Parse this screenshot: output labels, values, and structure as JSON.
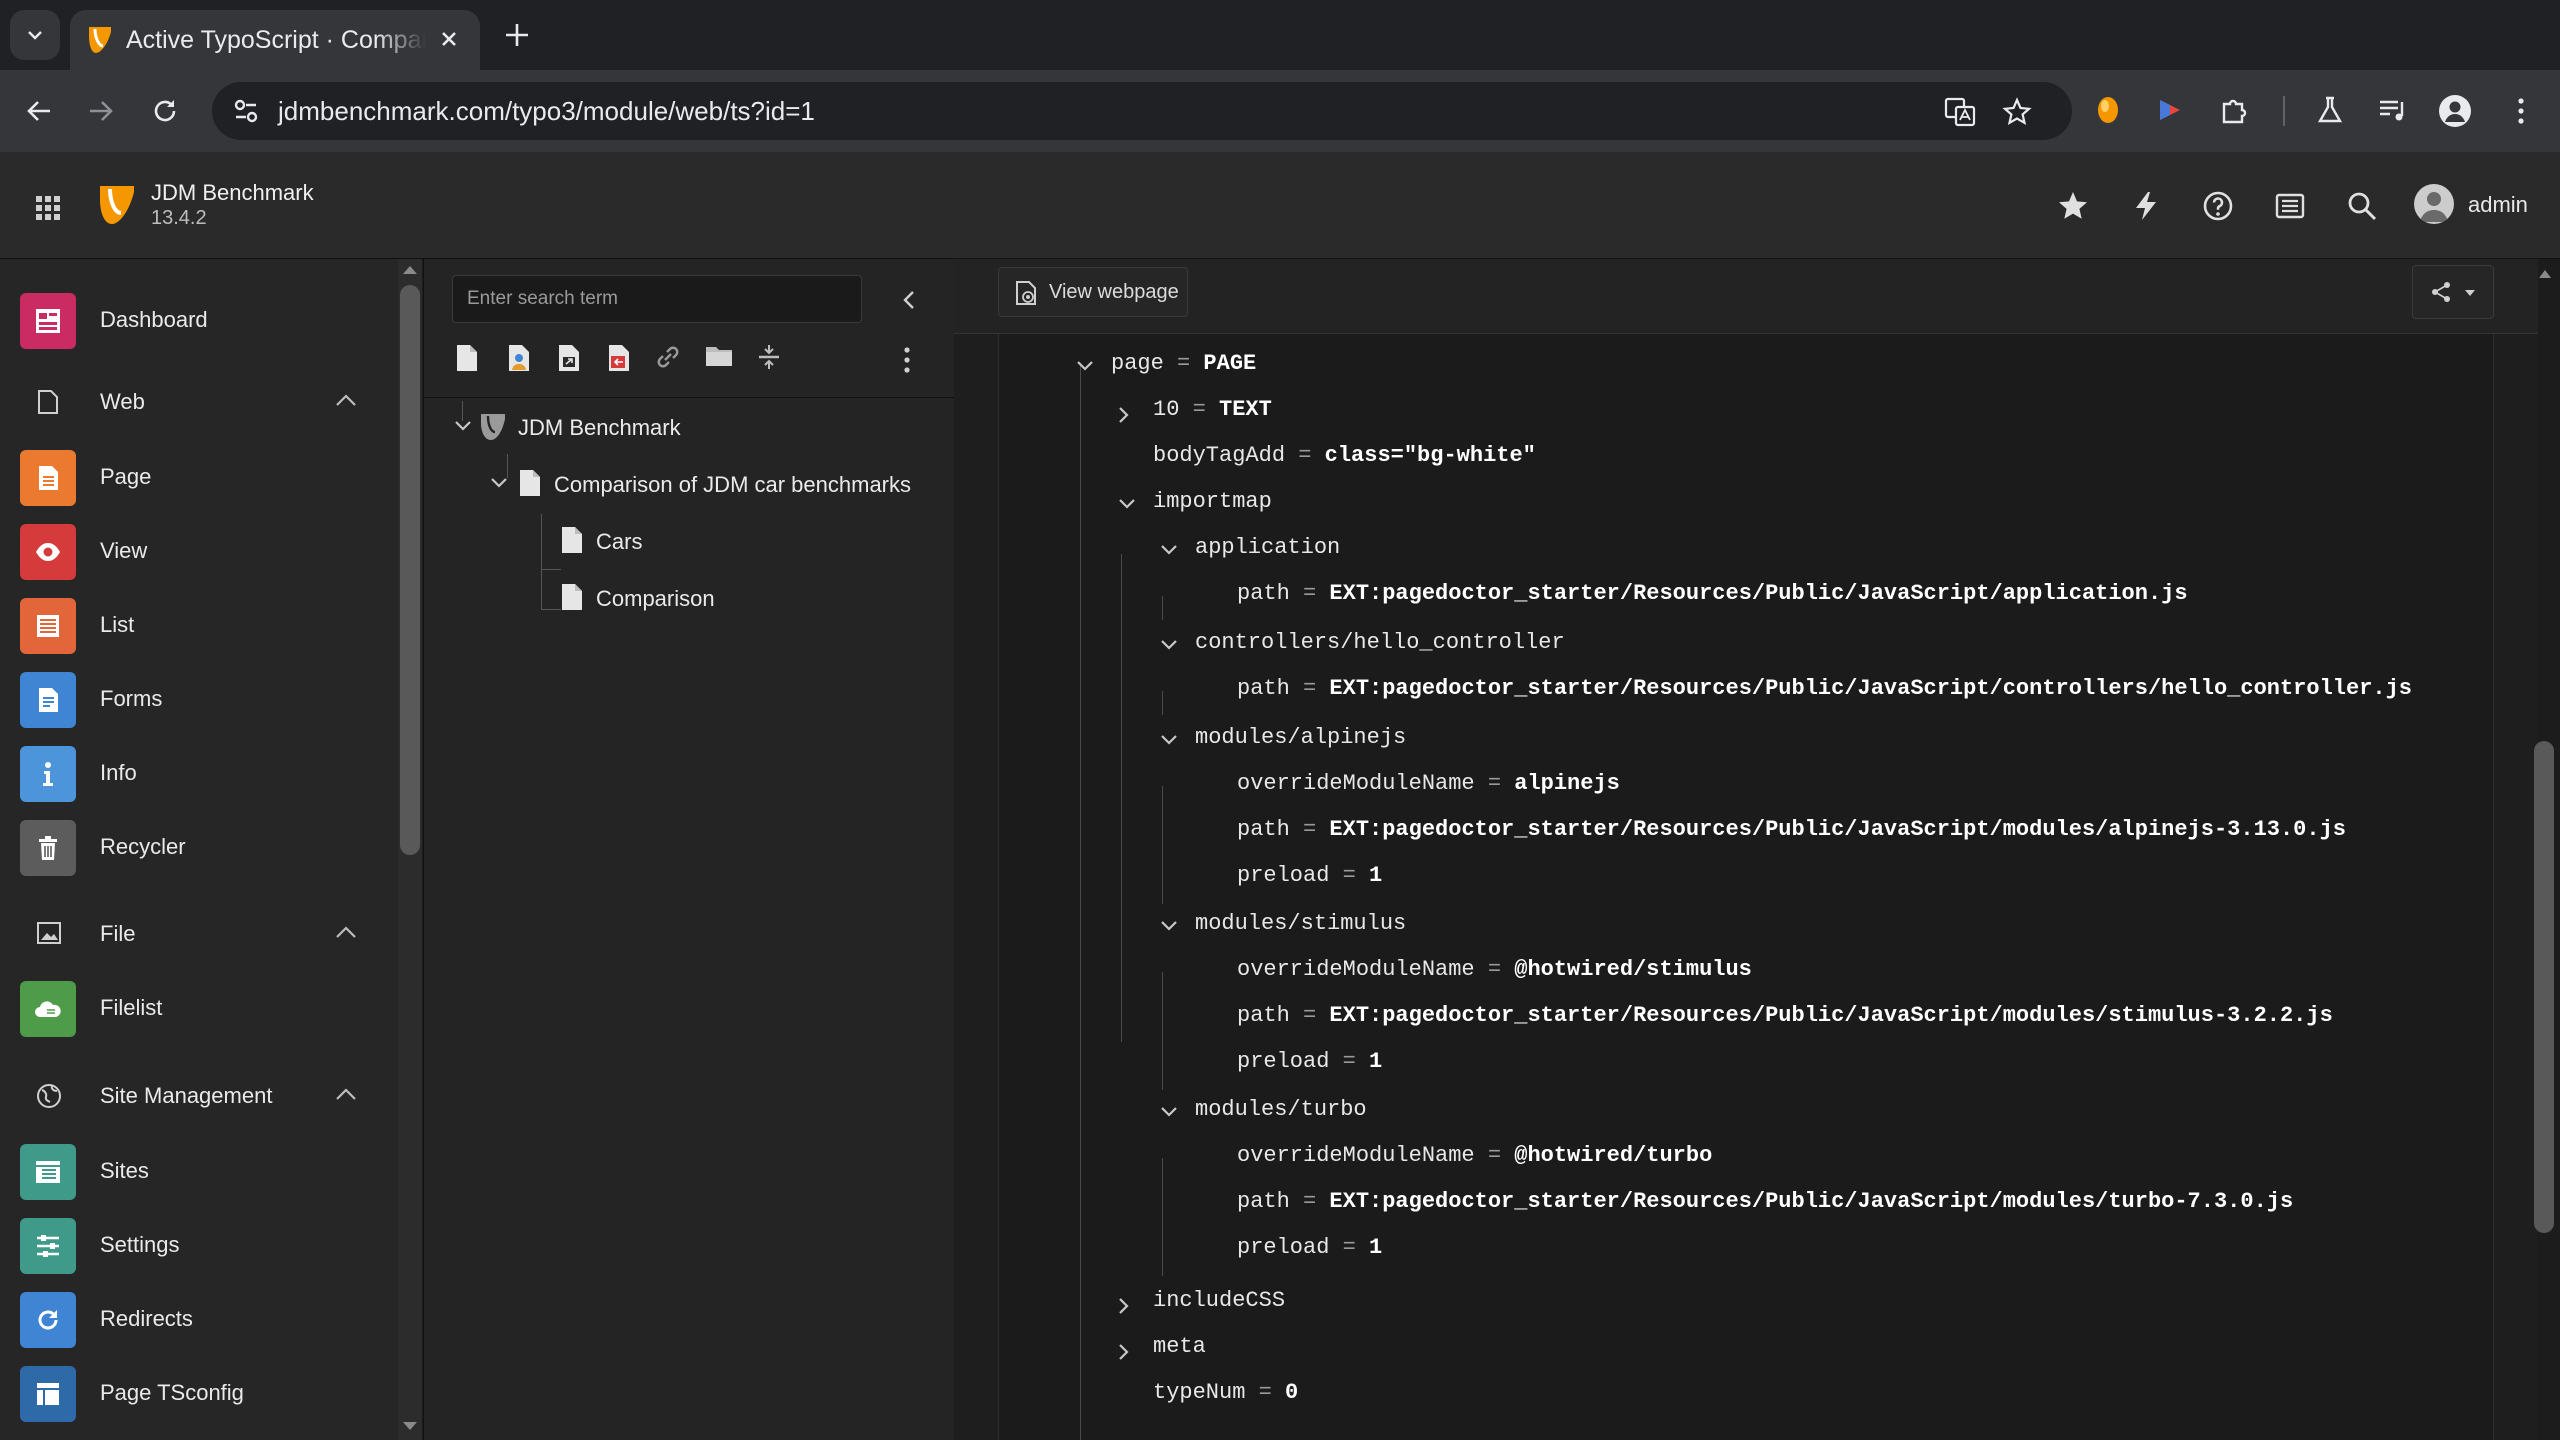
{
  "browser": {
    "tab_title": "Active TypoScript · Comparison of JDM car benchmarks",
    "url": "jdmbenchmark.com/typo3/module/web/ts?id=1"
  },
  "topbar": {
    "site_name": "JDM Benchmark",
    "version": "13.4.2",
    "username": "admin"
  },
  "modules": {
    "dashboard": "Dashboard",
    "web": "Web",
    "page": "Page",
    "view": "View",
    "list": "List",
    "forms": "Forms",
    "info": "Info",
    "recycler": "Recycler",
    "file": "File",
    "filelist": "Filelist",
    "site_management": "Site Management",
    "sites": "Sites",
    "settings": "Settings",
    "redirects": "Redirects",
    "page_tsconfig": "Page TSconfig"
  },
  "tree": {
    "search_placeholder": "Enter search term",
    "root": "JDM Benchmark",
    "page1": "Comparison of JDM car benchmarks",
    "page2": "Cars",
    "page3": "Comparison"
  },
  "content": {
    "view_webpage": "View webpage"
  },
  "typoscript": {
    "r0": {
      "key": "page",
      "op": "=",
      "val": "PAGE"
    },
    "r1": {
      "key": "10",
      "op": "=",
      "val": "TEXT"
    },
    "r2": {
      "key": "bodyTagAdd",
      "op": "=",
      "val": "class=\"bg-white\""
    },
    "r3": {
      "key": "importmap"
    },
    "r4": {
      "key": "application"
    },
    "r5": {
      "key": "path",
      "op": "=",
      "val": "EXT:pagedoctor_starter/Resources/Public/JavaScript/application.js"
    },
    "r6": {
      "key": "controllers/hello_controller"
    },
    "r7": {
      "key": "path",
      "op": "=",
      "val": "EXT:pagedoctor_starter/Resources/Public/JavaScript/controllers/hello_controller.js"
    },
    "r8": {
      "key": "modules/alpinejs"
    },
    "r9": {
      "key": "overrideModuleName",
      "op": "=",
      "val": "alpinejs"
    },
    "r10": {
      "key": "path",
      "op": "=",
      "val": "EXT:pagedoctor_starter/Resources/Public/JavaScript/modules/alpinejs-3.13.0.js"
    },
    "r11": {
      "key": "preload",
      "op": "=",
      "val": "1"
    },
    "r12": {
      "key": "modules/stimulus"
    },
    "r13": {
      "key": "overrideModuleName",
      "op": "=",
      "val": "@hotwired/stimulus"
    },
    "r14": {
      "key": "path",
      "op": "=",
      "val": "EXT:pagedoctor_starter/Resources/Public/JavaScript/modules/stimulus-3.2.2.js"
    },
    "r15": {
      "key": "preload",
      "op": "=",
      "val": "1"
    },
    "r16": {
      "key": "modules/turbo"
    },
    "r17": {
      "key": "overrideModuleName",
      "op": "=",
      "val": "@hotwired/turbo"
    },
    "r18": {
      "key": "path",
      "op": "=",
      "val": "EXT:pagedoctor_starter/Resources/Public/JavaScript/modules/turbo-7.3.0.js"
    },
    "r19": {
      "key": "preload",
      "op": "=",
      "val": "1"
    },
    "r20": {
      "key": "includeCSS"
    },
    "r21": {
      "key": "meta"
    },
    "r22": {
      "key": "typeNum",
      "op": "=",
      "val": "0"
    }
  }
}
